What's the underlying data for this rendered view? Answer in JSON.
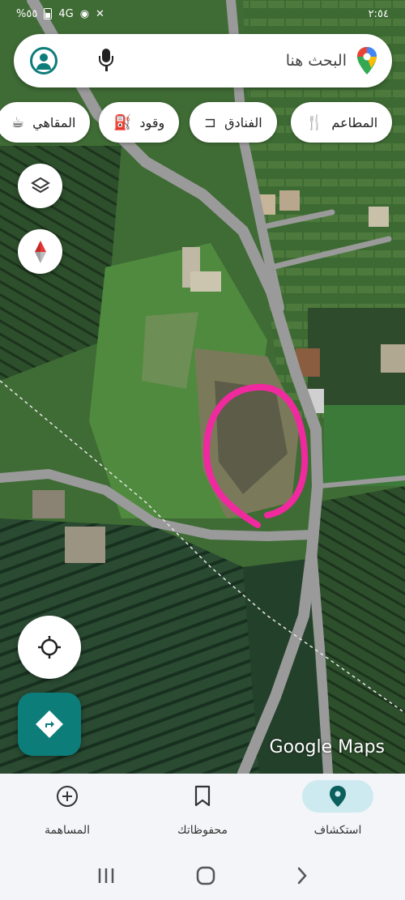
{
  "status_bar": {
    "time": "٢:٥٤",
    "battery": "%٥٥",
    "network": "4G"
  },
  "search": {
    "placeholder": "البحث هنا"
  },
  "chips": [
    {
      "label": "المطاعم",
      "icon": "fork-knife-icon"
    },
    {
      "label": "الفنادق",
      "icon": "bed-icon"
    },
    {
      "label": "وقود",
      "icon": "fuel-pump-icon"
    },
    {
      "label": "المقاهي",
      "icon": "coffee-cup-icon"
    }
  ],
  "map": {
    "view": "satellite",
    "attribution": "Google Maps",
    "annotation": "pink-hand-drawn-circle",
    "colors": {
      "annotation": "#f0299f",
      "road": "#9a9a9a"
    }
  },
  "bottom_nav": {
    "tabs": [
      {
        "label": "المساهمة",
        "icon": "plus-circle-icon"
      },
      {
        "label": "محفوظاتك",
        "icon": "bookmark-icon"
      },
      {
        "label": "استكشاف",
        "icon": "location-pin-icon",
        "active": true
      }
    ]
  },
  "system_nav": [
    "recents",
    "home",
    "back"
  ],
  "colors": {
    "accent": "#0d7d7a",
    "active_tab_bg": "#cdeaf0"
  }
}
